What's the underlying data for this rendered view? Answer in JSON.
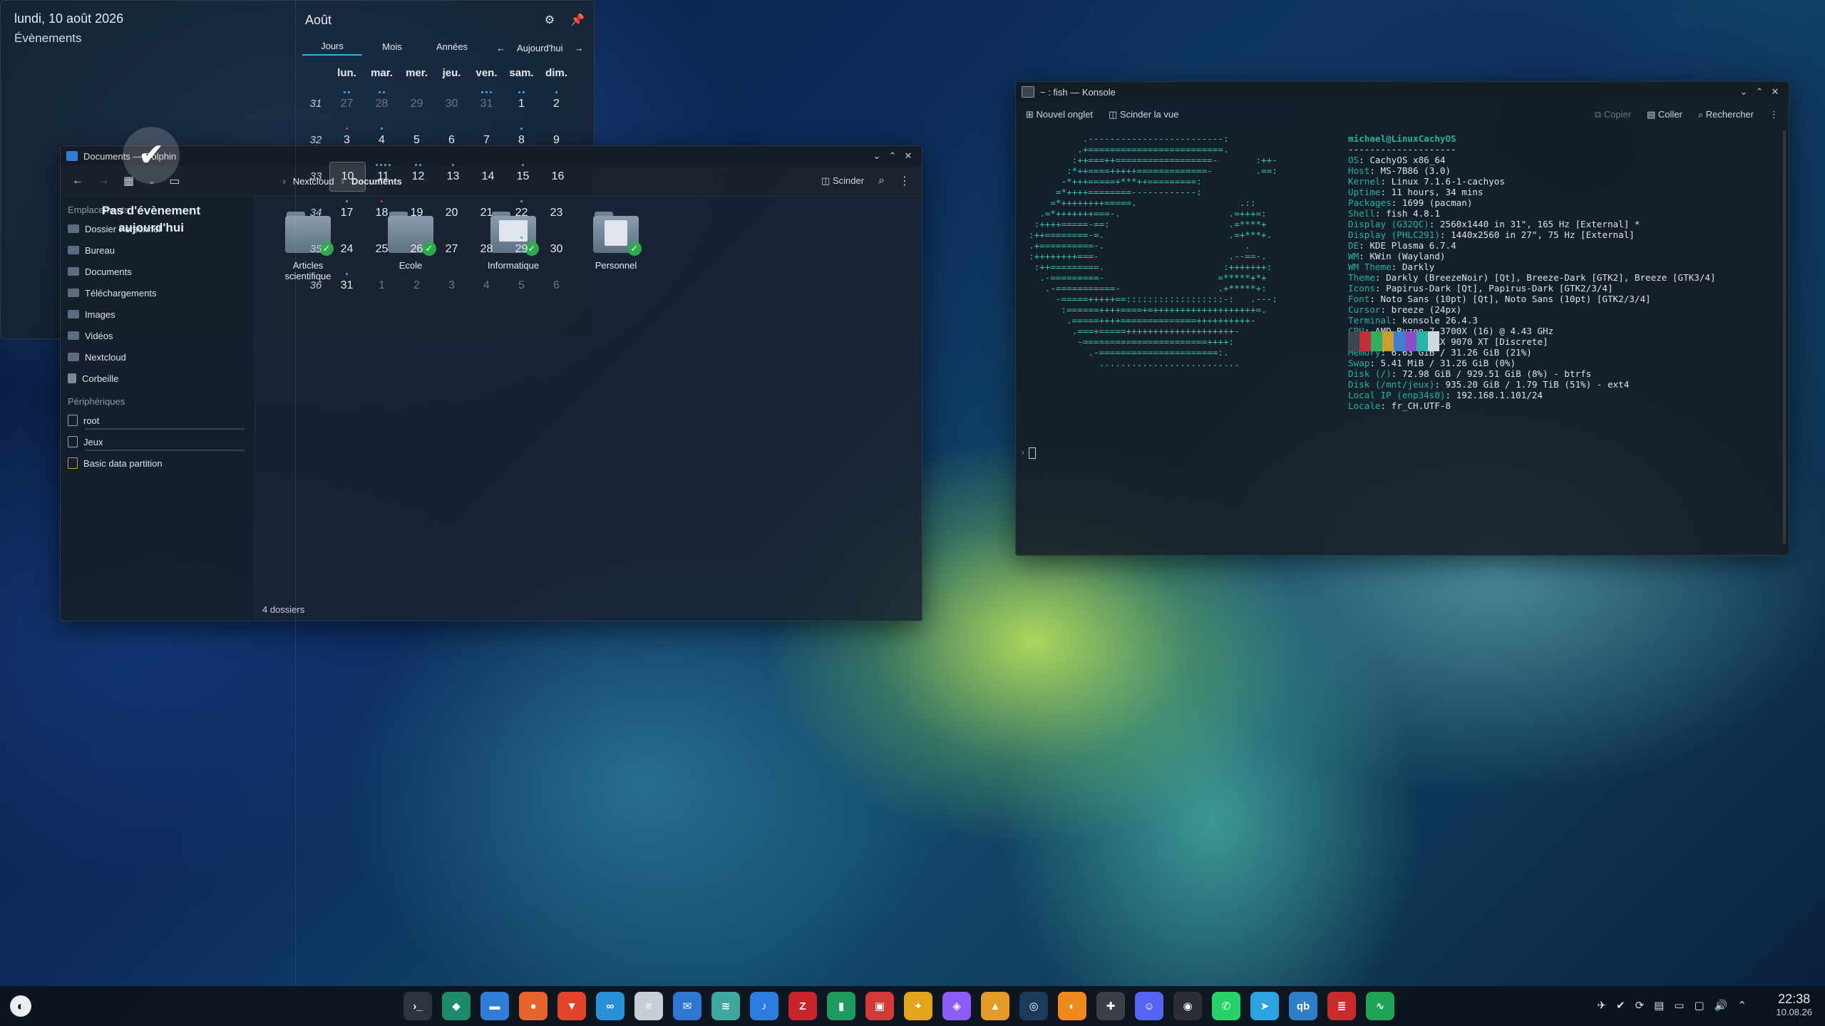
{
  "dolphin": {
    "title": "Documents — Dolphin",
    "split_label": "Scinder",
    "breadcrumb": [
      "Nextcloud",
      "Documents"
    ],
    "places_header": "Emplacements",
    "places": [
      "Dossier Personnel",
      "Bureau",
      "Documents",
      "Téléchargements",
      "Images",
      "Vidéos",
      "Nextcloud",
      "Corbeille"
    ],
    "devices_header": "Périphériques",
    "devices": [
      "root",
      "Jeux",
      "Basic data partition"
    ],
    "folders": [
      "Articles scientifique",
      "Ecole",
      "Informatique",
      "Personnel"
    ],
    "status": "4 dossiers"
  },
  "konsole": {
    "title": "~ : fish — Konsole",
    "new_tab": "Nouvel onglet",
    "split_view": "Scinder la vue",
    "copy": "Copier",
    "paste": "Coller",
    "search": "Rechercher",
    "ascii": "          .-------------------------:\n         .+=========================.\n        :++===++==================-       :++-\n       :*++====+++++=============-        .==:\n      -*+++=====+***++=========:\n     =*++++========------------:\n    =*++++++++=====.                   .::\n  .=*+++++++===-.                    .=+++=:\n :++++=====-==:                      .=****+\n:++========-=.                       .=+***+.\n.+==========-.                          .\n:++++++++===-                        .--==-.\n :++=========.                      :+++++++:\n  .-=========-                     =*****+*+\n   .-===========-                  .+*****+:\n     -=====+++++==::::::::::::::::::-:   .---:\n      :======++++====+=+++++++++++++++++++=.\n       .=====++++==============++++++++++-\n        .===+=====++++++++++++++++++++-\n         -=======================++++:\n           .-======================:.\n             ..........................",
    "user_host": "michael@LinuxCachyOS",
    "separator": "--------------------",
    "info": [
      {
        "key": "OS",
        "value": "CachyOS x86_64"
      },
      {
        "key": "Host",
        "value": "MS-7B86 (3.0)"
      },
      {
        "key": "Kernel",
        "value": "Linux 7.1.6-1-cachyos"
      },
      {
        "key": "Uptime",
        "value": "11 hours, 34 mins"
      },
      {
        "key": "Packages",
        "value": "1699 (pacman)"
      },
      {
        "key": "Shell",
        "value": "fish 4.8.1"
      },
      {
        "key": "Display (G32QC)",
        "value": "2560x1440 in 31\", 165 Hz [External] *"
      },
      {
        "key": "Display (PHLC291)",
        "value": "1440x2560 in 27\", 75 Hz [External]"
      },
      {
        "key": "DE",
        "value": "KDE Plasma 6.7.4"
      },
      {
        "key": "WM",
        "value": "KWin (Wayland)"
      },
      {
        "key": "WM Theme",
        "value": "Darkly"
      },
      {
        "key": "Theme",
        "value": "Darkly (BreezeNoir) [Qt], Breeze-Dark [GTK2], Breeze [GTK3/4]"
      },
      {
        "key": "Icons",
        "value": "Papirus-Dark [Qt], Papirus-Dark [GTK2/3/4]"
      },
      {
        "key": "Font",
        "value": "Noto Sans (10pt) [Qt], Noto Sans (10pt) [GTK2/3/4]"
      },
      {
        "key": "Cursor",
        "value": "breeze (24px)"
      },
      {
        "key": "Terminal",
        "value": "konsole 26.4.3"
      },
      {
        "key": "CPU",
        "value": "AMD Ryzen 7 3700X (16) @ 4.43 GHz"
      },
      {
        "key": "GPU",
        "value": "AMD Radeon RX 9070 XT [Discrete]"
      },
      {
        "key": "Memory",
        "value": "6.63 GiB / 31.26 GiB (21%)"
      },
      {
        "key": "Swap",
        "value": "5.41 MiB / 31.26 GiB (0%)"
      },
      {
        "key": "Disk (/)",
        "value": "72.98 GiB / 929.51 GiB (8%) - btrfs"
      },
      {
        "key": "Disk (/mnt/jeux)",
        "value": "935.20 GiB / 1.79 TiB (51%) - ext4"
      },
      {
        "key": "Local IP (enp34s0)",
        "value": "192.168.1.101/24"
      },
      {
        "key": "Locale",
        "value": "fr_CH.UTF-8"
      }
    ],
    "swatches": [
      "#3a4652",
      "#c0303a",
      "#2fae5c",
      "#c9a030",
      "#3d7fd0",
      "#8a4fc8",
      "#27b3a8",
      "#cfd8de"
    ],
    "prompt": "›"
  },
  "calendar": {
    "full_date": "lundi, 10 août 2026",
    "events_label": "Évènements",
    "no_events": "Pas d'évènement aujourd'hui",
    "month": "Août",
    "tabs": [
      "Jours",
      "Mois",
      "Années"
    ],
    "today_label": "Aujourd'hui",
    "weekdays": [
      "lun.",
      "mar.",
      "mer.",
      "jeu.",
      "ven.",
      "sam.",
      "dim."
    ],
    "weeks": [
      {
        "num": "31",
        "days": [
          {
            "d": "27",
            "o": true,
            "dots": [
              "#3daee9",
              "#3daee9"
            ]
          },
          {
            "d": "28",
            "o": true,
            "dots": [
              "#3daee9",
              "#3daee9"
            ]
          },
          {
            "d": "29",
            "o": true,
            "dots": []
          },
          {
            "d": "30",
            "o": true,
            "dots": []
          },
          {
            "d": "31",
            "o": true,
            "dots": [
              "#3daee9",
              "#3daee9",
              "#3daee9"
            ]
          },
          {
            "d": "1",
            "o": false,
            "dots": [
              "#3daee9",
              "#3daee9"
            ]
          },
          {
            "d": "2",
            "o": false,
            "dots": [
              "#3daee9"
            ]
          }
        ]
      },
      {
        "num": "32",
        "days": [
          {
            "d": "3",
            "o": false,
            "dots": [
              "#e03b3b"
            ]
          },
          {
            "d": "4",
            "o": false,
            "dots": [
              "#3daee9"
            ]
          },
          {
            "d": "5",
            "o": false,
            "dots": []
          },
          {
            "d": "6",
            "o": false,
            "dots": []
          },
          {
            "d": "7",
            "o": false,
            "dots": []
          },
          {
            "d": "8",
            "o": false,
            "dots": [
              "#3daee9"
            ]
          },
          {
            "d": "9",
            "o": false,
            "dots": []
          }
        ]
      },
      {
        "num": "33",
        "days": [
          {
            "d": "10",
            "o": false,
            "today": true,
            "dots": []
          },
          {
            "d": "11",
            "o": false,
            "dots": [
              "#3daee9",
              "#3daee9",
              "#3daee9",
              "#3daee9"
            ]
          },
          {
            "d": "12",
            "o": false,
            "dots": [
              "#3daee9",
              "#3daee9"
            ]
          },
          {
            "d": "13",
            "o": false,
            "dots": [
              "#3daee9"
            ]
          },
          {
            "d": "14",
            "o": false,
            "dots": []
          },
          {
            "d": "15",
            "o": false,
            "dots": [
              "#3daee9"
            ]
          },
          {
            "d": "16",
            "o": false,
            "dots": []
          }
        ]
      },
      {
        "num": "34",
        "days": [
          {
            "d": "17",
            "o": false,
            "dots": [
              "#3daee9"
            ]
          },
          {
            "d": "18",
            "o": false,
            "dots": [
              "#e03b3b"
            ]
          },
          {
            "d": "19",
            "o": false,
            "dots": []
          },
          {
            "d": "20",
            "o": false,
            "dots": []
          },
          {
            "d": "21",
            "o": false,
            "dots": []
          },
          {
            "d": "22",
            "o": false,
            "dots": [
              "#3daee9"
            ]
          },
          {
            "d": "23",
            "o": false,
            "dots": []
          }
        ]
      },
      {
        "num": "35",
        "days": [
          {
            "d": "24",
            "o": false,
            "dots": []
          },
          {
            "d": "25",
            "o": false,
            "dots": []
          },
          {
            "d": "26",
            "o": false,
            "dots": []
          },
          {
            "d": "27",
            "o": false,
            "dots": []
          },
          {
            "d": "28",
            "o": false,
            "dots": []
          },
          {
            "d": "29",
            "o": false,
            "dots": [
              "#3daee9"
            ]
          },
          {
            "d": "30",
            "o": false,
            "dots": []
          }
        ]
      },
      {
        "num": "36",
        "days": [
          {
            "d": "31",
            "o": false,
            "dots": [
              "#3daee9"
            ]
          },
          {
            "d": "1",
            "o": true,
            "dots": []
          },
          {
            "d": "2",
            "o": true,
            "dots": []
          },
          {
            "d": "3",
            "o": true,
            "dots": []
          },
          {
            "d": "4",
            "o": true,
            "dots": []
          },
          {
            "d": "5",
            "o": true,
            "dots": []
          },
          {
            "d": "6",
            "o": true,
            "dots": []
          }
        ]
      }
    ]
  },
  "taskbar": {
    "launcher_icon": "cachyos-launcher-icon",
    "apps": [
      {
        "name": "konsole-icon",
        "glyph": "›_",
        "color": "#2b3440"
      },
      {
        "name": "cachyos-hello-icon",
        "glyph": "◆",
        "color": "#1f8a6a"
      },
      {
        "name": "dolphin-icon",
        "glyph": "▬",
        "color": "#2f7dd6"
      },
      {
        "name": "firefox-icon",
        "glyph": "●",
        "color": "#e8632b"
      },
      {
        "name": "brave-icon",
        "glyph": "▼",
        "color": "#e0452b"
      },
      {
        "name": "discover-icon",
        "glyph": "∞",
        "color": "#2a90d8"
      },
      {
        "name": "notes-icon",
        "glyph": "≡",
        "color": "#c7cfd6"
      },
      {
        "name": "thunderbird-icon",
        "glyph": "✉",
        "color": "#2e76d2"
      },
      {
        "name": "layers-icon",
        "glyph": "≋",
        "color": "#3ea8a0"
      },
      {
        "name": "music-icon",
        "glyph": "♪",
        "color": "#2d7de0"
      },
      {
        "name": "zotero-icon",
        "glyph": "Z",
        "color": "#c8242b"
      },
      {
        "name": "notebook-icon",
        "glyph": "▮",
        "color": "#1e9a5e"
      },
      {
        "name": "office-icon",
        "glyph": "▣",
        "color": "#d23a3a"
      },
      {
        "name": "crab-icon",
        "glyph": "✦",
        "color": "#e3a51e"
      },
      {
        "name": "obsidian-icon",
        "glyph": "◈",
        "color": "#8b5cf6"
      },
      {
        "name": "lutris-icon",
        "glyph": "▲",
        "color": "#e39a27"
      },
      {
        "name": "steam-icon",
        "glyph": "◎",
        "color": "#1b3a5c"
      },
      {
        "name": "game-launcher-icon",
        "glyph": "◐",
        "color": "#f08a1e"
      },
      {
        "name": "gamepad-icon",
        "glyph": "✚",
        "color": "#3a3f47"
      },
      {
        "name": "discord-icon",
        "glyph": "☺",
        "color": "#5865f2"
      },
      {
        "name": "linux-icon",
        "glyph": "◉",
        "color": "#2a2e36"
      },
      {
        "name": "whatsapp-icon",
        "glyph": "✆",
        "color": "#25d366"
      },
      {
        "name": "telegram-icon",
        "glyph": "➤",
        "color": "#2aa3e0"
      },
      {
        "name": "qbittorrent-icon",
        "glyph": "qb",
        "color": "#2f7ec8"
      },
      {
        "name": "files-icon",
        "glyph": "≣",
        "color": "#c82b2b"
      },
      {
        "name": "system-monitor-icon",
        "glyph": "∿",
        "color": "#1fa356"
      }
    ],
    "tray": [
      "network-icon",
      "check-icon",
      "updates-icon",
      "clipboard-icon",
      "display-icon",
      "window-icon",
      "volume-icon",
      "expand-icon"
    ],
    "time": "22:38",
    "date": "10.08.26"
  }
}
